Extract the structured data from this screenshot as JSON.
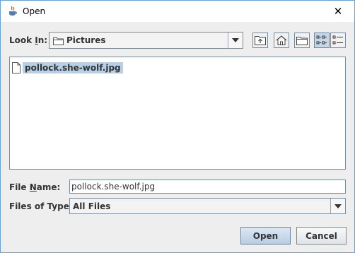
{
  "window": {
    "title": "Open",
    "close_glyph": "✕"
  },
  "look_in": {
    "label_pre": "Look ",
    "label_mnemonic": "I",
    "label_post": "n:",
    "value": "Pictures"
  },
  "toolbar": {
    "buttons": [
      {
        "name": "up-one-level-button",
        "icon": "folder-up-icon"
      },
      {
        "name": "home-button",
        "icon": "home-icon"
      },
      {
        "name": "new-folder-button",
        "icon": "new-folder-icon"
      },
      {
        "name": "list-view-button",
        "icon": "list-view-icon",
        "selected": true
      },
      {
        "name": "details-view-button",
        "icon": "details-view-icon"
      }
    ]
  },
  "files": [
    {
      "name": "pollock.she-wolf.jpg",
      "selected": true
    }
  ],
  "file_name": {
    "label_pre": "File ",
    "label_mnemonic": "N",
    "label_post": "ame:",
    "value": "pollock.she-wolf.jpg"
  },
  "file_type": {
    "label": "Files of Type:",
    "value": "All Files"
  },
  "buttons": {
    "open": "Open",
    "cancel": "Cancel"
  },
  "colors": {
    "selection": "#b8cfe5",
    "border": "#7a8a99",
    "background": "#eeeeee"
  }
}
